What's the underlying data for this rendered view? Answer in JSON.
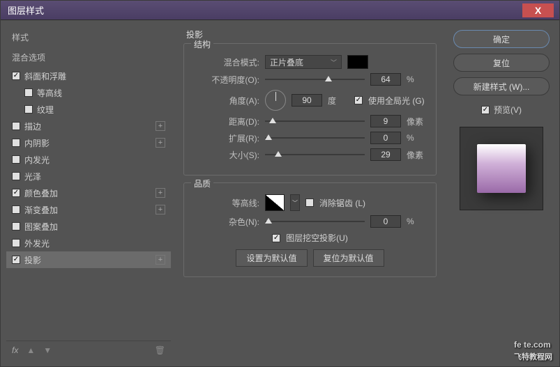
{
  "window": {
    "title": "图层样式",
    "close": "X"
  },
  "left": {
    "styles_header": "样式",
    "blend_header": "混合选项",
    "items": [
      {
        "label": "斜面和浮雕",
        "checked": true,
        "hasPlus": false,
        "indent": false
      },
      {
        "label": "等高线",
        "checked": false,
        "hasPlus": false,
        "indent": true
      },
      {
        "label": "纹理",
        "checked": false,
        "hasPlus": false,
        "indent": true
      },
      {
        "label": "描边",
        "checked": false,
        "hasPlus": true,
        "indent": false
      },
      {
        "label": "内阴影",
        "checked": false,
        "hasPlus": true,
        "indent": false
      },
      {
        "label": "内发光",
        "checked": false,
        "hasPlus": false,
        "indent": false
      },
      {
        "label": "光泽",
        "checked": false,
        "hasPlus": false,
        "indent": false
      },
      {
        "label": "颜色叠加",
        "checked": true,
        "hasPlus": true,
        "indent": false
      },
      {
        "label": "渐变叠加",
        "checked": false,
        "hasPlus": true,
        "indent": false
      },
      {
        "label": "图案叠加",
        "checked": false,
        "hasPlus": false,
        "indent": false
      },
      {
        "label": "外发光",
        "checked": false,
        "hasPlus": false,
        "indent": false
      },
      {
        "label": "投影",
        "checked": true,
        "hasPlus": true,
        "indent": false,
        "selected": true
      }
    ],
    "fx": "fx"
  },
  "middle": {
    "title": "投影",
    "structure": {
      "legend": "结构",
      "blend_mode_label": "混合模式:",
      "blend_mode_value": "正片叠底",
      "opacity_label": "不透明度(O):",
      "opacity_value": "64",
      "opacity_unit": "%",
      "angle_label": "角度(A):",
      "angle_value": "90",
      "angle_unit": "度",
      "global_light_label": "使用全局光 (G)",
      "global_light_checked": true,
      "distance_label": "距离(D):",
      "distance_value": "9",
      "distance_unit": "像素",
      "spread_label": "扩展(R):",
      "spread_value": "0",
      "spread_unit": "%",
      "size_label": "大小(S):",
      "size_value": "29",
      "size_unit": "像素"
    },
    "quality": {
      "legend": "品质",
      "contour_label": "等高线:",
      "antialias_label": "消除锯齿 (L)",
      "antialias_checked": false,
      "noise_label": "杂色(N):",
      "noise_value": "0",
      "noise_unit": "%"
    },
    "knockout_label": "图层挖空投影(U)",
    "knockout_checked": true,
    "set_default": "设置为默认值",
    "reset_default": "复位为默认值"
  },
  "right": {
    "ok": "确定",
    "cancel": "复位",
    "new_style": "新建样式 (W)...",
    "preview_label": "预览(V)",
    "preview_checked": true
  },
  "watermark": {
    "main": "fe te.com",
    "sub": "飞特教程网"
  }
}
